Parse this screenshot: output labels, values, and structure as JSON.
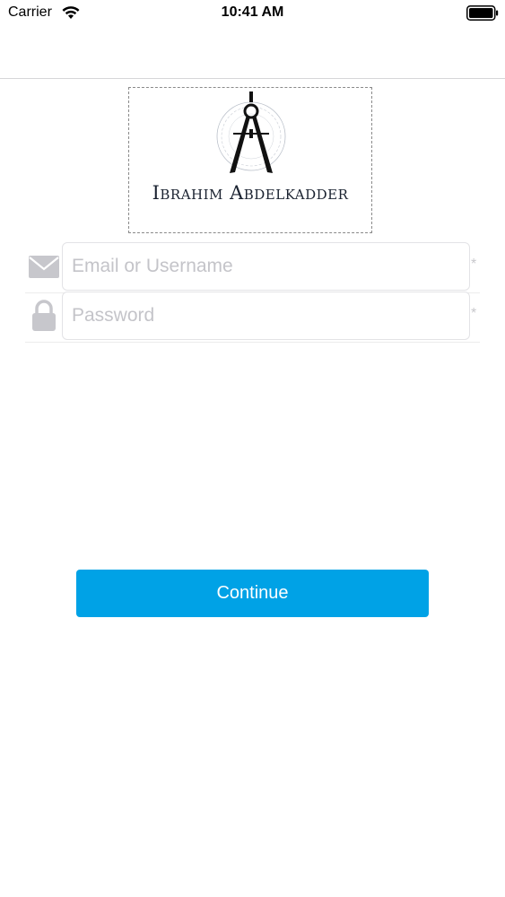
{
  "status_bar": {
    "carrier": "Carrier",
    "time": "10:41 AM",
    "wifi_icon": "wifi-icon",
    "battery_icon": "battery-icon",
    "battery_level": 1.0
  },
  "logo": {
    "text": "Ibrahim Abdelkadder",
    "icon": "drafting-compass-icon"
  },
  "form": {
    "email": {
      "icon": "mail-icon",
      "placeholder": "Email or Username",
      "value": "",
      "required_mark": "*"
    },
    "password": {
      "icon": "lock-icon",
      "placeholder": "Password",
      "value": "",
      "required_mark": "*"
    }
  },
  "actions": {
    "continue_label": "Continue"
  },
  "colors": {
    "accent": "#00a2e6",
    "icon_gray": "#c7c7cc",
    "placeholder": "#c4c4c9"
  }
}
